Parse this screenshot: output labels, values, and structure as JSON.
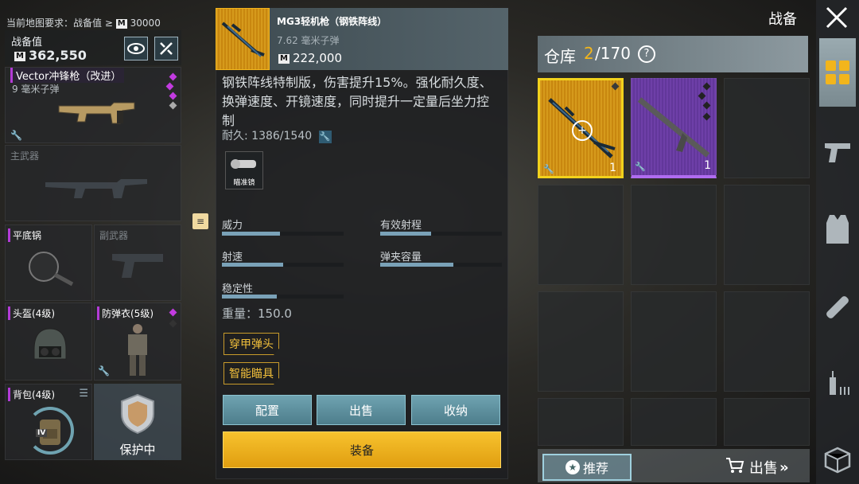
{
  "top_bar": {
    "map_requirement": "当前地图要求：战备值 ≥",
    "badge": "M",
    "requirement_value": "30000"
  },
  "readiness": {
    "label": "战备值",
    "badge": "M",
    "value": "362,550"
  },
  "slots": {
    "primary_weapon": {
      "name": "Vector冲锋枪（改进）",
      "ammo": "9 毫米子弹"
    },
    "main_weapon_label": "主武器",
    "pan_label": "平底锅",
    "secondary_label": "副武器",
    "helmet_label": "头盔(4级)",
    "armor_label": "防弹衣(5级)",
    "backpack_label": "背包(4级)",
    "backpack_level": "IV",
    "protect_label": "保护中"
  },
  "item": {
    "name": "MG3轻机枪（钢铁阵线）",
    "ammo": "7.62 毫米子弹",
    "badge": "M",
    "price": "222,000",
    "description": "钢铁阵线特制版，伤害提升15%。强化耐久度、换弹速度、开镜速度，同时提升一定量后坐力控制",
    "durability": "耐久: 1386/1540",
    "attachment_label": "瞄准镜",
    "stats": [
      {
        "label": "威力",
        "value": 0.48
      },
      {
        "label": "有效射程",
        "value": 0.42
      },
      {
        "label": "射速",
        "value": 0.5
      },
      {
        "label": "弹夹容量",
        "value": 0.6
      },
      {
        "label": "稳定性",
        "value": 0.45
      }
    ],
    "weight": "重量：150.0",
    "tags": [
      "穿甲弹头",
      "智能瞄具"
    ],
    "buttons": {
      "config": "配置",
      "sell": "出售",
      "store": "收纳",
      "equip": "装备"
    }
  },
  "warehouse": {
    "section_title": "战备",
    "title": "仓库",
    "count_current": "2",
    "count_total": "/170",
    "help": "?",
    "item_count_1": "1",
    "item_count_2": "1",
    "recommend": "推荐",
    "sell": "出售"
  },
  "colors": {
    "accent": "#f2b51c",
    "purple": "#6e3fa8",
    "teal": "#6fa3b1"
  },
  "sidebar_icons": [
    "grid-icon",
    "pistol-icon",
    "vest-icon",
    "bandage-icon",
    "syringe-icon",
    "crate-icon"
  ]
}
